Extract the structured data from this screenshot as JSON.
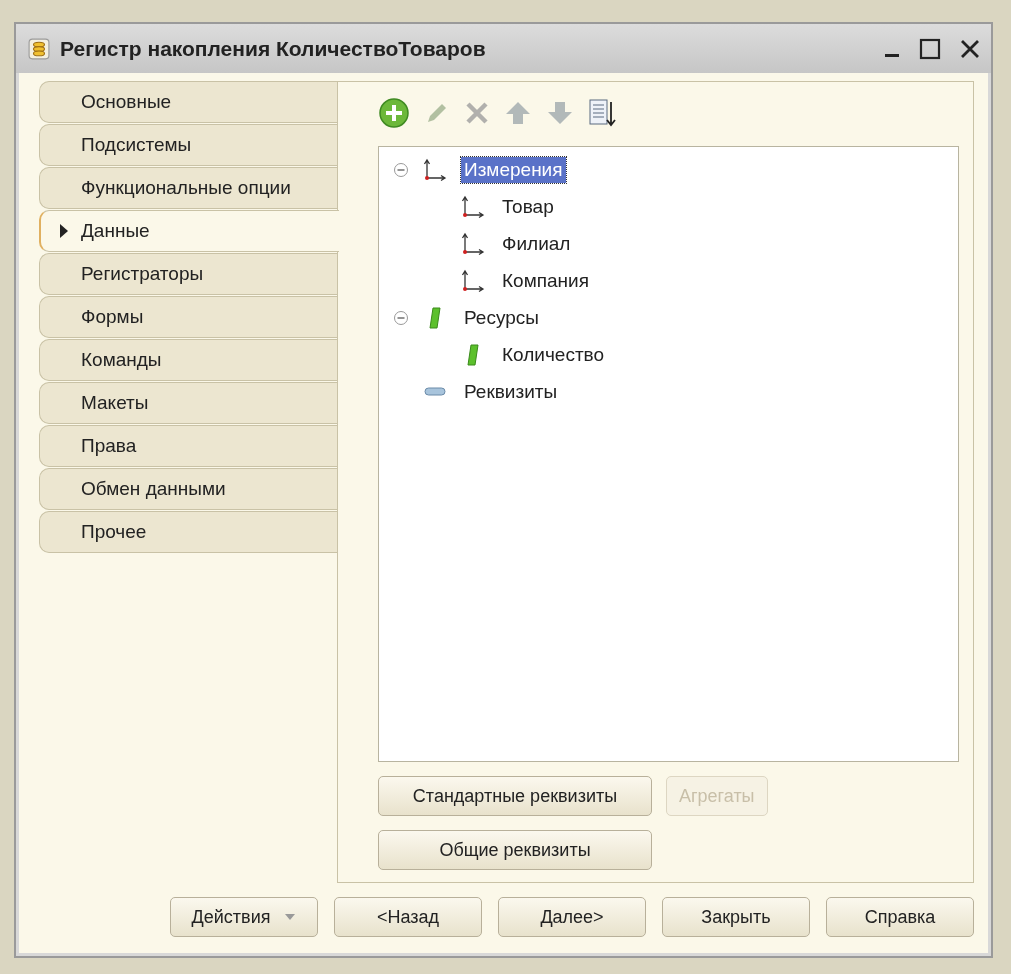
{
  "window": {
    "title": "Регистр накопления КоличествоТоваров"
  },
  "tabs": [
    {
      "label": "Основные",
      "selected": false
    },
    {
      "label": "Подсистемы",
      "selected": false
    },
    {
      "label": "Функциональные опции",
      "selected": false
    },
    {
      "label": "Данные",
      "selected": true
    },
    {
      "label": "Регистраторы",
      "selected": false
    },
    {
      "label": "Формы",
      "selected": false
    },
    {
      "label": "Команды",
      "selected": false
    },
    {
      "label": "Макеты",
      "selected": false
    },
    {
      "label": "Права",
      "selected": false
    },
    {
      "label": "Обмен данными",
      "selected": false
    },
    {
      "label": "Прочее",
      "selected": false
    }
  ],
  "toolbar": [
    {
      "kind": "add",
      "disabled": false
    },
    {
      "kind": "edit",
      "disabled": true
    },
    {
      "kind": "delete",
      "disabled": true
    },
    {
      "kind": "up",
      "disabled": true
    },
    {
      "kind": "down",
      "disabled": true
    },
    {
      "kind": "sort",
      "disabled": false
    }
  ],
  "tree": [
    {
      "label": "Измерения",
      "kind": "dimension",
      "expanded": true,
      "selected": true,
      "children": [
        {
          "label": "Товар",
          "kind": "dimension",
          "selected": false
        },
        {
          "label": "Филиал",
          "kind": "dimension",
          "selected": false
        },
        {
          "label": "Компания",
          "kind": "dimension",
          "selected": false
        }
      ]
    },
    {
      "label": "Ресурсы",
      "kind": "resource",
      "expanded": true,
      "selected": false,
      "children": [
        {
          "label": "Количество",
          "kind": "resource",
          "selected": false
        }
      ]
    },
    {
      "label": "Реквизиты",
      "kind": "attribute",
      "selected": false
    }
  ],
  "panel_buttons": [
    {
      "label": "Стандартные реквизиты",
      "disabled": false
    },
    {
      "label": "Агрегаты",
      "disabled": true
    },
    {
      "label": "Общие реквизиты",
      "disabled": false
    }
  ],
  "footer_buttons": [
    {
      "label": "Действия",
      "kind": "dropdown"
    },
    {
      "label": "<Назад",
      "kind": "plain"
    },
    {
      "label": "Далее>",
      "kind": "plain"
    },
    {
      "label": "Закрыть",
      "kind": "plain"
    },
    {
      "label": "Справка",
      "kind": "plain"
    }
  ]
}
